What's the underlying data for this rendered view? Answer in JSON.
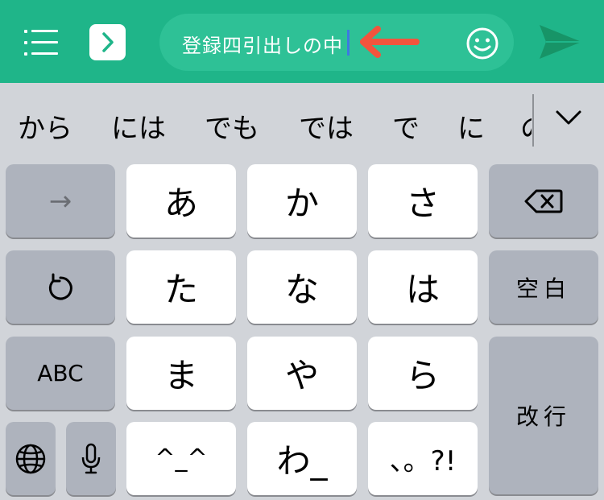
{
  "top_bar": {
    "message_input": {
      "value": "登録四引出しの中"
    },
    "colors": {
      "bar": "#1fb589",
      "annotation_arrow": "#f2543d"
    }
  },
  "suggestions": {
    "items": [
      "から",
      "には",
      "でも",
      "では",
      "で",
      "に",
      "の"
    ]
  },
  "keyboard": {
    "kana": {
      "a": "あ",
      "ka": "か",
      "sa": "さ",
      "ta": "た",
      "na": "な",
      "ha": "は",
      "ma": "ま",
      "ya": "や",
      "ra": "ら",
      "kaomoji": "^_^",
      "wa": "わ_",
      "punct": "、。?!"
    },
    "functions": {
      "next": "→",
      "abc": "ABC",
      "space": "空白",
      "enter": "改行"
    },
    "icons": [
      "arrow-right-icon",
      "undo-icon",
      "backspace-icon",
      "globe-icon",
      "microphone-icon",
      "menu-icon",
      "expand-icon",
      "emoji-icon",
      "send-icon"
    ]
  }
}
